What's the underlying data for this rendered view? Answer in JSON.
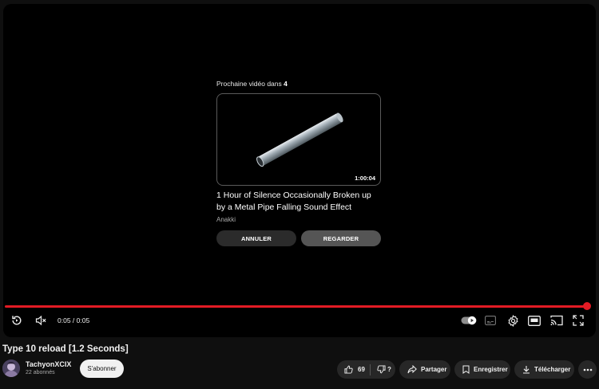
{
  "player": {
    "endscreen": {
      "upnext_prefix": "Prochaine vidéo dans",
      "countdown": "4",
      "duration": "1:00:04",
      "title": "1 Hour of Silence Occasionally Broken up by a Metal Pipe Falling Sound Effect",
      "channel": "Anakki",
      "cancel_label": "ANNULER",
      "watch_label": "REGARDER"
    },
    "progress_fraction": 1.0,
    "time": "0:05 / 0:05",
    "autoplay_on": true,
    "accent_color": "#e21b24"
  },
  "video": {
    "title": "Type 10 reload [1.2 Seconds]",
    "channel": "TachyonXCIX",
    "subscribers": "22 abonnés",
    "subscribe_label": "S'abonner",
    "likes": "69",
    "dislike_label": "?",
    "share_label": "Partager",
    "save_label": "Enregistrer",
    "download_label": "Télécharger"
  },
  "icons": [
    "replay-icon",
    "mute-icon",
    "autoplay-toggle-icon",
    "subtitles-icon",
    "settings-icon",
    "theater-icon",
    "cast-icon",
    "fullscreen-icon",
    "like-icon",
    "dislike-icon",
    "share-icon",
    "save-icon",
    "download-icon",
    "more-icon"
  ]
}
